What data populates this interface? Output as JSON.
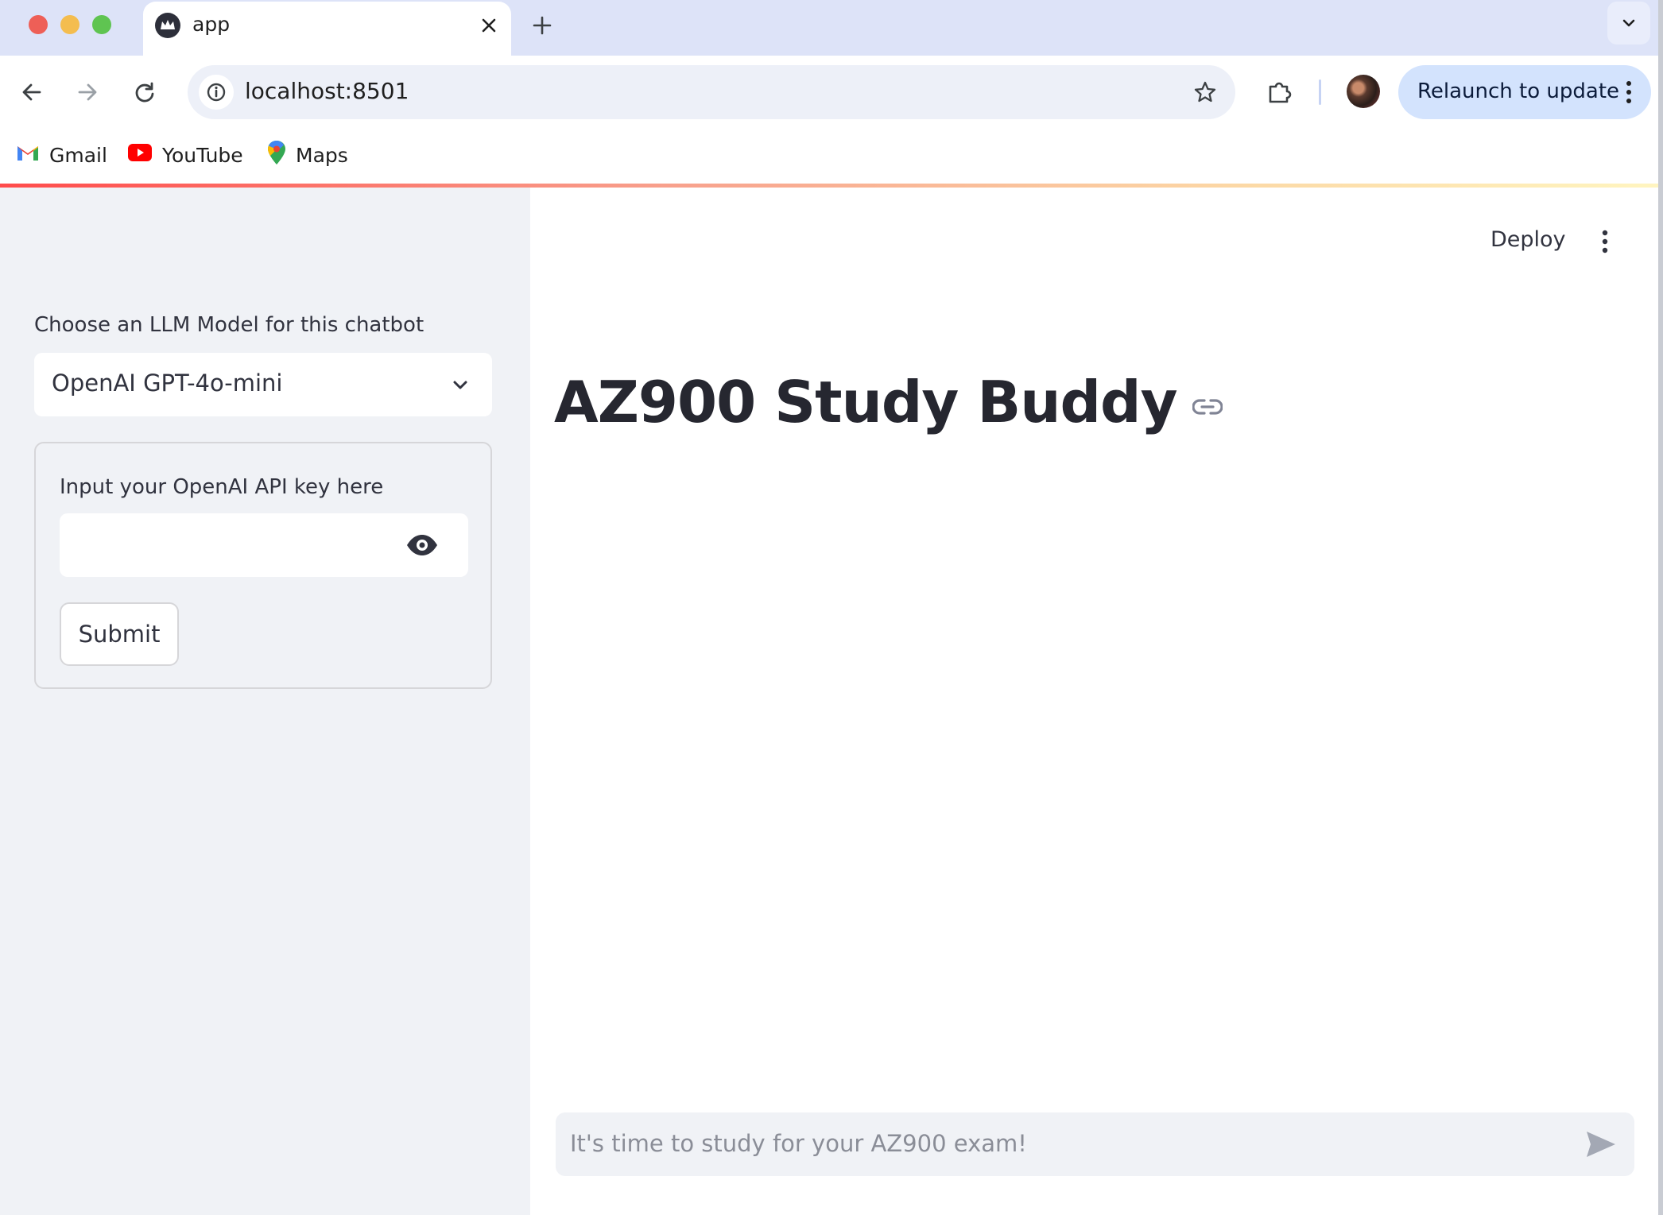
{
  "browser": {
    "tab": {
      "title": "app"
    },
    "address": {
      "url": "localhost:8501"
    },
    "relaunch_label": "Relaunch to update",
    "bookmarks": [
      {
        "label": "Gmail",
        "icon": "gmail-icon"
      },
      {
        "label": "YouTube",
        "icon": "youtube-icon"
      },
      {
        "label": "Maps",
        "icon": "maps-icon"
      }
    ]
  },
  "sidebar": {
    "model_select": {
      "label": "Choose an LLM Model for this chatbot",
      "value": "OpenAI GPT-4o-mini"
    },
    "api_form": {
      "label": "Input your OpenAI API key here",
      "value": "",
      "submit_label": "Submit"
    }
  },
  "header": {
    "deploy_label": "Deploy"
  },
  "main": {
    "title": "AZ900 Study Buddy",
    "chat_input": {
      "placeholder": "It's time to study for your AZ900 exam!"
    }
  },
  "colors": {
    "sidebar_bg": "#f0f2f6",
    "title_text": "#262730",
    "accent_gradient_start": "#ff4b4b",
    "relaunch_bg": "#d3e3fd",
    "tabstrip_bg": "#dde3f8"
  }
}
